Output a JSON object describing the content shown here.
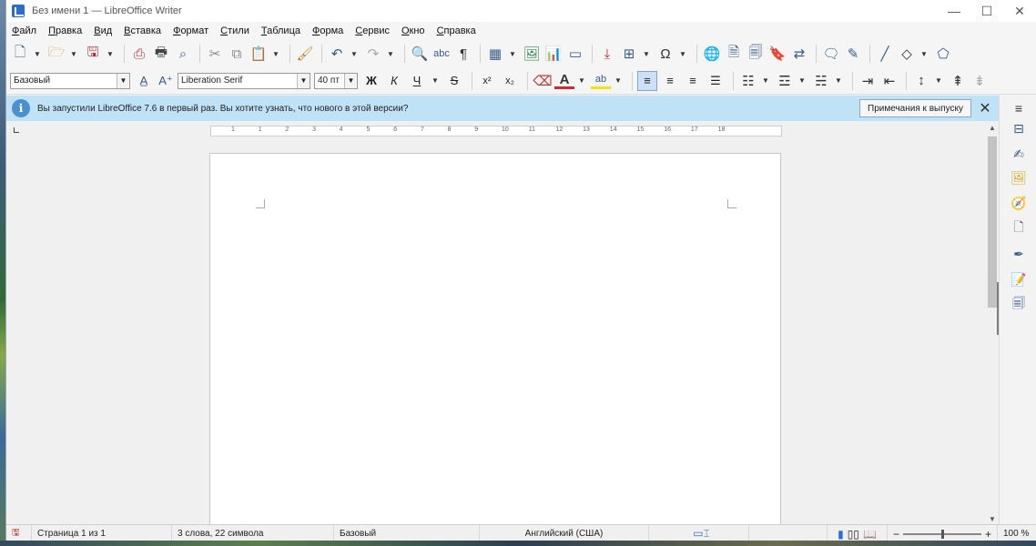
{
  "window": {
    "title": "Без имени 1 — LibreOffice Writer",
    "minimize": "—",
    "maximize": "☐",
    "close": "✕"
  },
  "menu": [
    "Файл",
    "Правка",
    "Вид",
    "Вставка",
    "Формат",
    "Стили",
    "Таблица",
    "Форма",
    "Сервис",
    "Окно",
    "Справка"
  ],
  "formatting": {
    "paragraph_style": "Базовый",
    "font_name": "Liberation Serif",
    "font_size": "40 пт",
    "bold": "Ж",
    "italic": "К",
    "underline": "Ч",
    "strike": "S",
    "superscript": "x²",
    "subscript": "x₂"
  },
  "infobar": {
    "icon": "i",
    "message": "Вы запустили LibreOffice 7.6 в первый раз. Вы хотите узнать, что нового в этой версии?",
    "button": "Примечания к выпуску",
    "close": "✕"
  },
  "ruler": {
    "labels": [
      "1",
      "1",
      "2",
      "3",
      "4",
      "5",
      "6",
      "7",
      "8",
      "9",
      "10",
      "11",
      "12",
      "13",
      "14",
      "15",
      "16",
      "17",
      "18"
    ]
  },
  "status": {
    "page": "Страница 1 из 1",
    "words": "3 слова, 22 символа",
    "style": "Базовый",
    "language": "Английский (США)",
    "zoom": "100 %",
    "zoom_minus": "−",
    "zoom_plus": "+",
    "zoom_level_fraction": 0.5
  },
  "colors": {
    "accent": "#2a6fd0",
    "infobar_bg": "#bfe2f7",
    "font_color_bar": "#d42a2a",
    "highlight_bar": "#f7e017"
  }
}
